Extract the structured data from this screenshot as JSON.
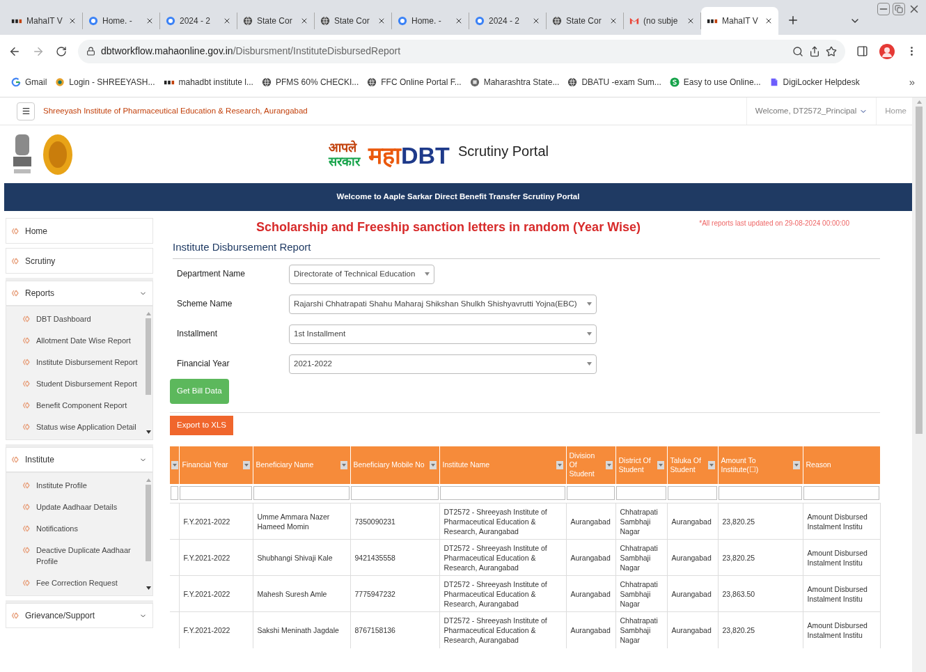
{
  "browser": {
    "tabs": [
      {
        "kind": "dbt",
        "title": "MahaIT V",
        "selected": false
      },
      {
        "kind": "home",
        "title": "Home. -",
        "selected": false
      },
      {
        "kind": "home",
        "title": "2024 - 2",
        "selected": false
      },
      {
        "kind": "globe",
        "title": "State Cor",
        "selected": false
      },
      {
        "kind": "globe",
        "title": "State Cor",
        "selected": false
      },
      {
        "kind": "home",
        "title": "Home. -",
        "selected": false
      },
      {
        "kind": "home",
        "title": "2024 - 2",
        "selected": false
      },
      {
        "kind": "globe",
        "title": "State Cor",
        "selected": false
      },
      {
        "kind": "mail",
        "title": "(no subje",
        "selected": false
      },
      {
        "kind": "dbt",
        "title": "MahaIT V",
        "selected": true
      }
    ],
    "url_host": "dbtworkflow.mahaonline.gov.in",
    "url_path": "/Disbursment/InstituteDisbursedReport",
    "bookmarks": [
      {
        "kind": "g",
        "title": "Gmail"
      },
      {
        "kind": "circle",
        "title": "Login - SHREEYASH..."
      },
      {
        "kind": "dbt",
        "title": "mahadbt institute l..."
      },
      {
        "kind": "globe",
        "title": "PFMS 60% CHECKI..."
      },
      {
        "kind": "globe",
        "title": "FFC Online Portal F..."
      },
      {
        "kind": "seal",
        "title": "Maharashtra State..."
      },
      {
        "kind": "globe",
        "title": "DBATU -exam Sum..."
      },
      {
        "kind": "s",
        "title": "Easy to use Online..."
      },
      {
        "kind": "doc",
        "title": "DigiLocker Helpdesk"
      }
    ],
    "overflow": "»"
  },
  "topbar": {
    "institute": "Shreeyash Institute of Pharmaceutical Education & Research, Aurangabad",
    "user": "Welcome, DT2572_Principal",
    "home": "Home"
  },
  "logo": {
    "aaple": "आपले",
    "sarkar": "सरकार",
    "maha": "महा",
    "dbt": "DBT",
    "portal": "Scrutiny Portal"
  },
  "banner": "Welcome to Aaple Sarkar Direct Benefit Transfer Scrutiny Portal",
  "sidebar": [
    {
      "label": "Home",
      "kind": "link"
    },
    {
      "label": "Scrutiny",
      "kind": "link"
    },
    {
      "label": "Reports",
      "kind": "group",
      "expanded": true,
      "children": [
        "DBT Dashboard",
        "Allotment Date Wise Report",
        "Institute Disbursement Report",
        "Student Disbursement Report",
        "Benefit Component Report",
        "Status wise Application Detail"
      ]
    },
    {
      "label": "Institute",
      "kind": "group",
      "expanded": true,
      "children": [
        "Institute Profile",
        "Update Aadhaar Details",
        "Notifications",
        "Deactive Duplicate Aadhaar Profile",
        "Fee Correction Request"
      ]
    },
    {
      "label": "Grievance/Support",
      "kind": "group",
      "expanded": true
    }
  ],
  "headline": "Scholarship and Freeship sanction letters in random (Year Wise)",
  "updated_note": "*All reports last updated on 29-08-2024 00:00:00",
  "report_title": "Institute Disbursement Report",
  "filters": [
    {
      "label": "Department Name",
      "value": "Directorate of Technical Education",
      "wide": false
    },
    {
      "label": "Scheme Name",
      "value": "Rajarshi Chhatrapati Shahu Maharaj Shikshan Shulkh Shishyavrutti Yojna(EBC)",
      "wide": true
    },
    {
      "label": "Installment",
      "value": "1st Installment",
      "wide": true
    },
    {
      "label": "Financial Year",
      "value": "2021-2022",
      "wide": true
    }
  ],
  "get_button": "Get Bill Data",
  "export_button": "Export to XLS",
  "table": {
    "columns": [
      "Financial Year",
      "Beneficiary Name",
      "Beneficiary Mobile No",
      "Institute Name",
      "Division Of Student",
      "District Of Student",
      "Taluka Of Student",
      "Amount To Institute(☐)",
      "Reason"
    ],
    "rows": [
      [
        "F.Y.2021-2022",
        "Umme Ammara Nazer Hameed Momin",
        "7350090231",
        "DT2572 - Shreeyash Institute of Pharmaceutical Education & Research, Aurangabad",
        "Aurangabad",
        "Chhatrapati Sambhaji Nagar",
        "Aurangabad",
        "23,820.25",
        "Amount Disbursed Instalment Institu"
      ],
      [
        "F.Y.2021-2022",
        "Shubhangi Shivaji Kale",
        "9421435558",
        "DT2572 - Shreeyash Institute of Pharmaceutical Education & Research, Aurangabad",
        "Aurangabad",
        "Chhatrapati Sambhaji Nagar",
        "Aurangabad",
        "23,820.25",
        "Amount Disbursed Instalment Institu"
      ],
      [
        "F.Y.2021-2022",
        "Mahesh Suresh Amle",
        "7775947232",
        "DT2572 - Shreeyash Institute of Pharmaceutical Education & Research, Aurangabad",
        "Aurangabad",
        "Chhatrapati Sambhaji Nagar",
        "Aurangabad",
        "23,863.50",
        "Amount Disbursed Instalment Institu"
      ],
      [
        "F.Y.2021-2022",
        "Sakshi Meninath Jagdale",
        "8767158136",
        "DT2572 - Shreeyash Institute of Pharmaceutical Education & Research, Aurangabad",
        "Aurangabad",
        "Chhatrapati Sambhaji Nagar",
        "Aurangabad",
        "23,820.25",
        "Amount Disbursed Instalment Institu"
      ]
    ]
  }
}
